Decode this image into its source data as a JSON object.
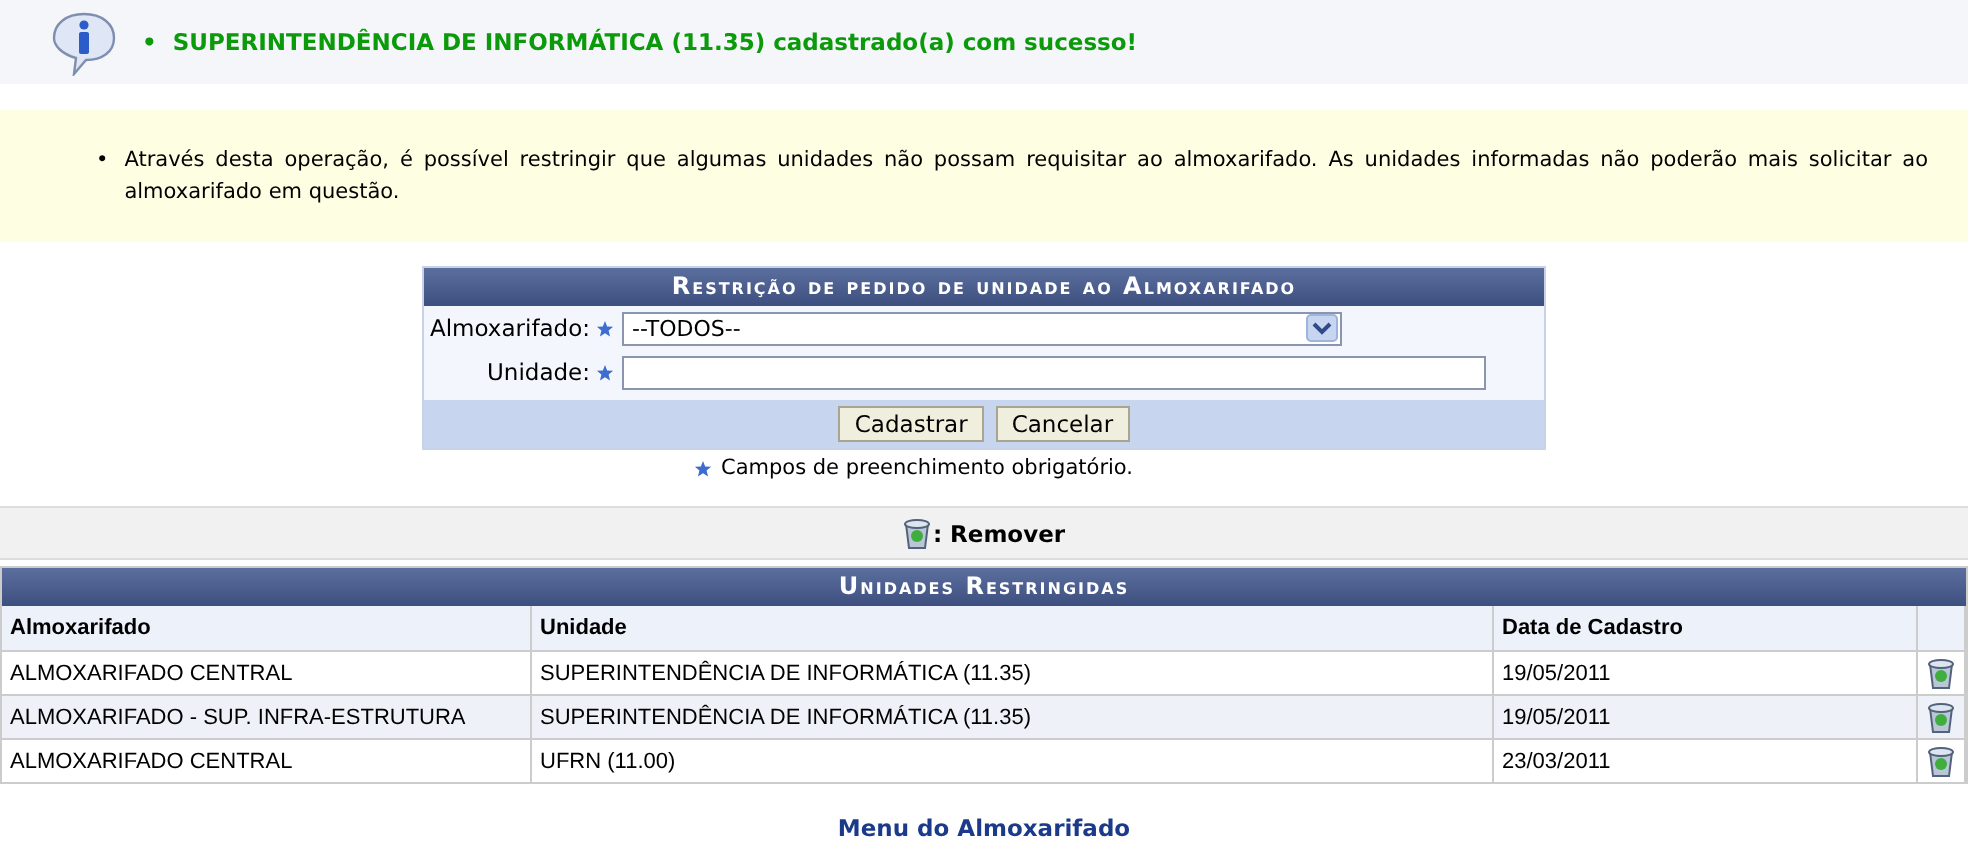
{
  "messages": [
    {
      "bullet": "•",
      "text": "SUPERINTENDÊNCIA DE INFORMÁTICA (11.35) cadastrado(a) com sucesso!"
    }
  ],
  "instruction_bullet": "•",
  "instructions": [
    "Através desta operação, é possível restringir que algumas unidades não possam requisitar ao almoxarifado. As unidades informadas não poderão mais solicitar ao almoxarifado em questão."
  ],
  "form": {
    "title": "Restrição de pedido de unidade ao Almoxarifado",
    "fields": [
      {
        "kind": "select",
        "label": "Almoxarifado:",
        "value": "--TODOS--"
      },
      {
        "kind": "text",
        "label": "Unidade:"
      }
    ],
    "buttons": [
      "Cadastrar",
      "Cancelar"
    ],
    "required_note": "Campos de preenchimento obrigatório."
  },
  "legend": {
    "label": ": Remover"
  },
  "table": {
    "title": "Unidades Restringidas",
    "columns": [
      "Almoxarifado",
      "Unidade",
      "Data de Cadastro"
    ],
    "rows": [
      {
        "almoxarifado": "ALMOXARIFADO CENTRAL",
        "unidade": "SUPERINTENDÊNCIA DE INFORMÁTICA (11.35)",
        "data": "19/05/2011"
      },
      {
        "almoxarifado": "ALMOXARIFADO - SUP. INFRA-ESTRUTURA",
        "unidade": "SUPERINTENDÊNCIA DE INFORMÁTICA (11.35)",
        "data": "19/05/2011"
      },
      {
        "almoxarifado": "ALMOXARIFADO CENTRAL",
        "unidade": "UFRN (11.00)",
        "data": "23/03/2011"
      }
    ]
  },
  "footer_link": "Menu do Almoxarifado"
}
